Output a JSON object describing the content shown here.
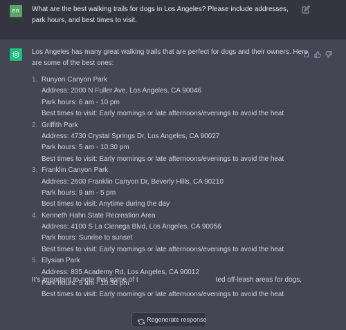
{
  "user_message": {
    "avatar_initials": "ER",
    "text": "What are the best walking trails for dogs in Los Angeles? Please include addresses, park hours, and best times to visit.",
    "edit_icon": "edit-icon"
  },
  "assistant_message": {
    "intro": "Los Angeles has many great walking trails that are perfect for dogs and their owners. Here are some of the best ones:",
    "trails": [
      {
        "number": "1.",
        "name": "Runyon Canyon Park",
        "address": "Address: 2000 N Fuller Ave, Los Angeles, CA 90046",
        "hours": "Park hours: 6 am - 10 pm",
        "best_times": "Best times to visit: Early mornings or late afternoons/evenings to avoid the heat"
      },
      {
        "number": "2.",
        "name": "Griffith Park",
        "address": "Address: 4730 Crystal Springs Dr, Los Angeles, CA 90027",
        "hours": "Park hours: 5 am - 10:30 pm",
        "best_times": "Best times to visit: Early mornings or late afternoons/evenings to avoid the heat"
      },
      {
        "number": "3.",
        "name": "Franklin Canyon Park",
        "address": "Address: 2600 Franklin Canyon Dr, Beverly Hills, CA 90210",
        "hours": "Park hours: 9 am - 5 pm",
        "best_times": "Best times to visit: Anytime during the day"
      },
      {
        "number": "4.",
        "name": "Kenneth Hahn State Recreation Area",
        "address": "Address: 4100 S La Cienega Blvd, Los Angeles, CA 90056",
        "hours": "Park hours: Sunrise to sunset",
        "best_times": "Best times to visit: Early mornings or late afternoons/evenings to avoid the heat"
      },
      {
        "number": "5.",
        "name": "Elysian Park",
        "address": "Address: 835 Academy Rd, Los Angeles, CA 90012",
        "hours": "Park hours: 5 am - 10:30 pm",
        "best_times": "Best times to visit: Early mornings or late afternoons/evenings to avoid the heat"
      }
    ],
    "outro_start": "It's important to note that some of t",
    "outro_end": "ted off-leash areas for dogs,",
    "icons": [
      "clipboard-icon",
      "thumbs-up-icon",
      "thumbs-down-icon"
    ]
  },
  "regenerate": {
    "label": "Regenerate response",
    "icon": "refresh-icon"
  },
  "colors": {
    "user_bg": "#343541",
    "assistant_bg": "#444654",
    "user_avatar": "#5aa469",
    "assistant_avatar": "#19c37d"
  }
}
